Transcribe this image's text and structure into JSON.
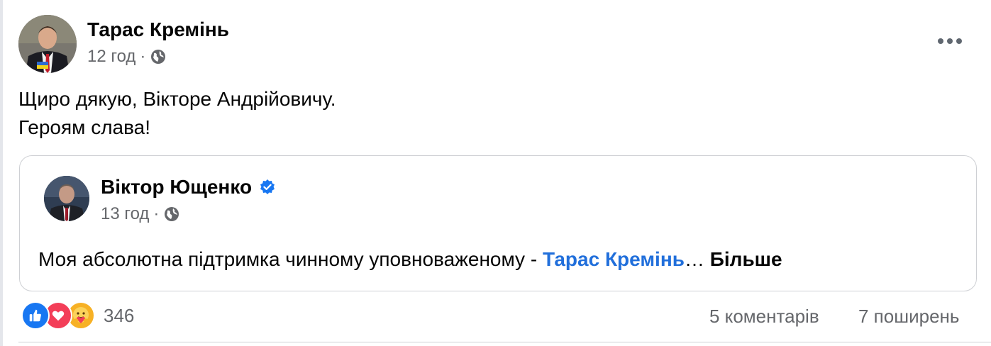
{
  "post": {
    "author": "Тарас Кремінь",
    "time": "12 год",
    "separator": "·",
    "privacy_icon": "globe-icon",
    "text_lines": [
      "Щиро дякую, Вікторе Андрійовичу.",
      "Героям слава!"
    ]
  },
  "shared": {
    "author": "Віктор Ющенко",
    "verified_icon": "verified-badge-icon",
    "time": "13 год",
    "separator": "·",
    "text": "Моя абсолютна підтримка чинному уповноваженому - ",
    "mention": "Тарас Кремінь",
    "ellipsis": "…",
    "more": "Більше"
  },
  "footer": {
    "reactions": [
      "like-icon",
      "love-icon",
      "care-icon"
    ],
    "reaction_count": "346",
    "comments": "5 коментарів",
    "shares": "7 поширень"
  },
  "colors": {
    "link": "#216fdb",
    "secondary_text": "#65676b",
    "like": "#1877f2",
    "love": "#f33e58",
    "care": "#f7b125"
  }
}
